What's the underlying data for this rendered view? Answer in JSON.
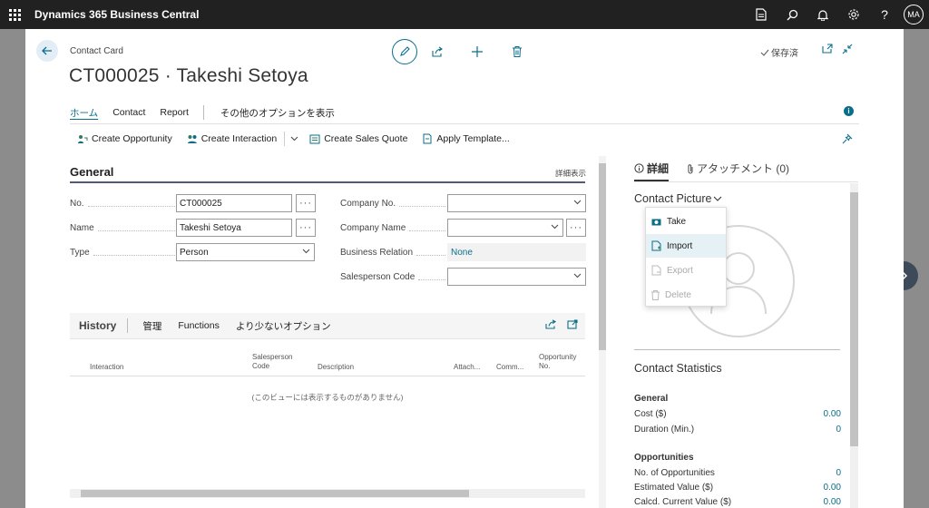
{
  "app": {
    "name": "Dynamics 365 Business Central",
    "avatar_initials": "MA"
  },
  "header": {
    "breadcrumb": "Contact Card",
    "title": "CT000025 · Takeshi Setoya",
    "saved_label": "保存済"
  },
  "nav": {
    "tabs": [
      "ホーム",
      "Contact",
      "Report"
    ],
    "more_label": "その他のオプションを表示"
  },
  "actions": [
    "Create Opportunity",
    "Create Interaction",
    "Create Sales Quote",
    "Apply Template..."
  ],
  "general": {
    "title": "General",
    "show_more": "詳細表示",
    "fields": {
      "no": {
        "label": "No.",
        "value": "CT000025"
      },
      "name": {
        "label": "Name",
        "value": "Takeshi Setoya"
      },
      "type": {
        "label": "Type",
        "value": "Person"
      },
      "company_no": {
        "label": "Company No.",
        "value": ""
      },
      "company_name": {
        "label": "Company Name",
        "value": ""
      },
      "business_relation": {
        "label": "Business Relation",
        "value": "None"
      },
      "salesperson_code": {
        "label": "Salesperson Code",
        "value": ""
      }
    }
  },
  "history": {
    "title": "History",
    "tabs": [
      "管理",
      "Functions",
      "より少ないオプション"
    ],
    "columns": {
      "interaction": "Interaction",
      "salesperson_l1": "Salesperson",
      "salesperson_l2": "Code",
      "description": "Description",
      "attach": "Attach...",
      "comm": "Comm...",
      "opportunity_l1": "Opportunity",
      "opportunity_l2": "No."
    },
    "empty_message": "(このビューには表示するものがありません)"
  },
  "factbox": {
    "tabs": {
      "details": "詳細",
      "attachments": "アタッチメント (0)"
    },
    "contact_picture": {
      "title": "Contact Picture",
      "menu": {
        "take": "Take",
        "import": "Import",
        "export": "Export",
        "delete": "Delete"
      }
    },
    "statistics": {
      "title": "Contact Statistics",
      "general": {
        "title": "General",
        "cost_label": "Cost ($)",
        "cost_value": "0.00",
        "duration_label": "Duration (Min.)",
        "duration_value": "0"
      },
      "opportunities": {
        "title": "Opportunities",
        "count_label": "No. of Opportunities",
        "count_value": "0",
        "estimated_label": "Estimated Value ($)",
        "estimated_value": "0.00",
        "calcd_label": "Calcd. Current Value ($)",
        "calcd_value": "0.00"
      }
    }
  },
  "colors": {
    "accent": "#0a6e8a",
    "appbar": "#212121",
    "nav_circle": "#3d4a5a"
  }
}
